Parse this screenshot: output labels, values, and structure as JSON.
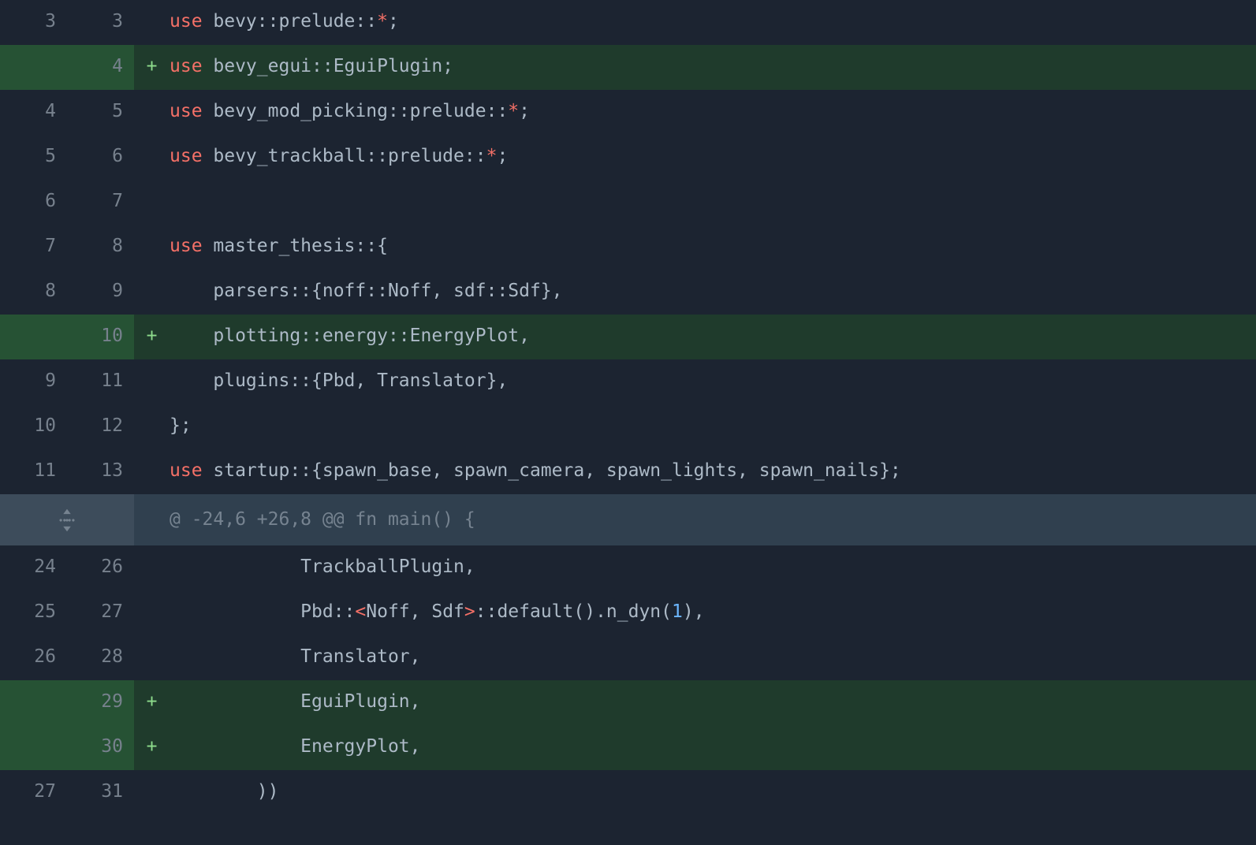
{
  "hunk": {
    "header": "@ -24,6 +26,8 @@ fn main() {"
  },
  "rows": [
    {
      "type": "context",
      "old": "3",
      "new": "3",
      "sign": " ",
      "segs": [
        {
          "c": "kw",
          "t": "use"
        },
        {
          "c": "",
          "t": " bevy::prelude::"
        },
        {
          "c": "star",
          "t": "*"
        },
        {
          "c": "",
          "t": ";"
        }
      ]
    },
    {
      "type": "addition",
      "old": "",
      "new": "4",
      "sign": "+",
      "segs": [
        {
          "c": "kw",
          "t": "use"
        },
        {
          "c": "",
          "t": " bevy_egui::EguiPlugin;"
        }
      ]
    },
    {
      "type": "context",
      "old": "4",
      "new": "5",
      "sign": " ",
      "segs": [
        {
          "c": "kw",
          "t": "use"
        },
        {
          "c": "",
          "t": " bevy_mod_picking::prelude::"
        },
        {
          "c": "star",
          "t": "*"
        },
        {
          "c": "",
          "t": ";"
        }
      ]
    },
    {
      "type": "context",
      "old": "5",
      "new": "6",
      "sign": " ",
      "segs": [
        {
          "c": "kw",
          "t": "use"
        },
        {
          "c": "",
          "t": " bevy_trackball::prelude::"
        },
        {
          "c": "star",
          "t": "*"
        },
        {
          "c": "",
          "t": ";"
        }
      ]
    },
    {
      "type": "context",
      "old": "6",
      "new": "7",
      "sign": " ",
      "segs": []
    },
    {
      "type": "context",
      "old": "7",
      "new": "8",
      "sign": " ",
      "segs": [
        {
          "c": "kw",
          "t": "use"
        },
        {
          "c": "",
          "t": " master_thesis::{"
        }
      ]
    },
    {
      "type": "context",
      "old": "8",
      "new": "9",
      "sign": " ",
      "segs": [
        {
          "c": "",
          "t": "    parsers::{noff::Noff, sdf::Sdf},"
        }
      ]
    },
    {
      "type": "addition",
      "old": "",
      "new": "10",
      "sign": "+",
      "segs": [
        {
          "c": "",
          "t": "    plotting::energy::EnergyPlot,"
        }
      ]
    },
    {
      "type": "context",
      "old": "9",
      "new": "11",
      "sign": " ",
      "segs": [
        {
          "c": "",
          "t": "    plugins::{Pbd, Translator},"
        }
      ]
    },
    {
      "type": "context",
      "old": "10",
      "new": "12",
      "sign": " ",
      "segs": [
        {
          "c": "",
          "t": "};"
        }
      ]
    },
    {
      "type": "context",
      "old": "11",
      "new": "13",
      "sign": " ",
      "segs": [
        {
          "c": "kw",
          "t": "use"
        },
        {
          "c": "",
          "t": " startup::{spawn_base, spawn_camera, spawn_lights, spawn_nails};"
        }
      ]
    },
    {
      "_hunk": true
    },
    {
      "type": "context",
      "old": "24",
      "new": "26",
      "sign": " ",
      "segs": [
        {
          "c": "",
          "t": "            TrackballPlugin,"
        }
      ]
    },
    {
      "type": "context",
      "old": "25",
      "new": "27",
      "sign": " ",
      "segs": [
        {
          "c": "",
          "t": "            Pbd::"
        },
        {
          "c": "lt",
          "t": "<"
        },
        {
          "c": "",
          "t": "Noff, Sdf"
        },
        {
          "c": "gt",
          "t": ">"
        },
        {
          "c": "",
          "t": "::default().n_dyn("
        },
        {
          "c": "num",
          "t": "1"
        },
        {
          "c": "",
          "t": "),"
        }
      ]
    },
    {
      "type": "context",
      "old": "26",
      "new": "28",
      "sign": " ",
      "segs": [
        {
          "c": "",
          "t": "            Translator,"
        }
      ]
    },
    {
      "type": "addition",
      "old": "",
      "new": "29",
      "sign": "+",
      "segs": [
        {
          "c": "",
          "t": "            EguiPlugin,"
        }
      ]
    },
    {
      "type": "addition",
      "old": "",
      "new": "30",
      "sign": "+",
      "segs": [
        {
          "c": "",
          "t": "            EnergyPlot,"
        }
      ]
    },
    {
      "type": "context",
      "old": "27",
      "new": "31",
      "sign": " ",
      "segs": [
        {
          "c": "",
          "t": "        ))"
        }
      ]
    }
  ]
}
